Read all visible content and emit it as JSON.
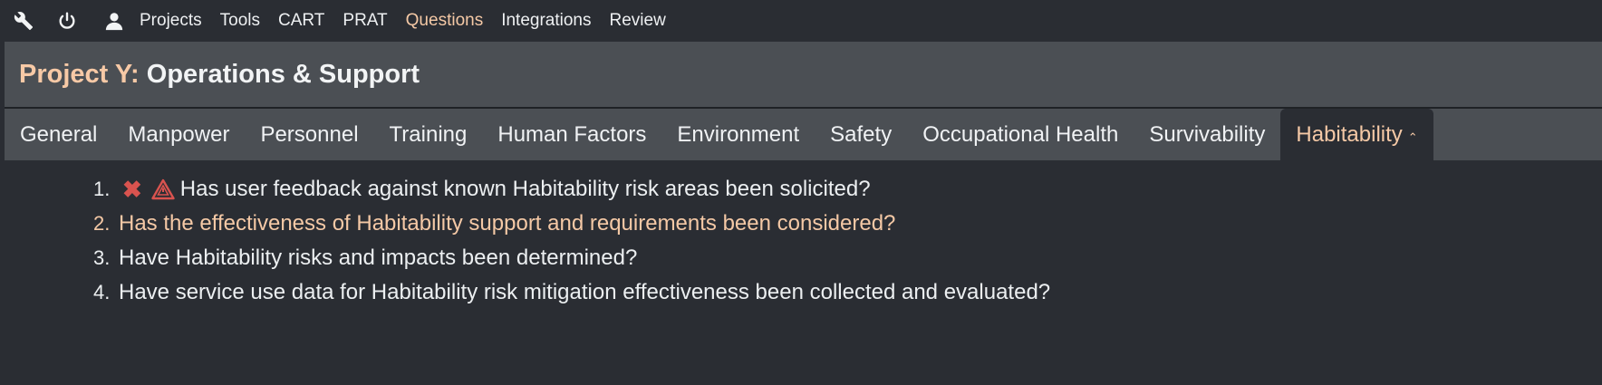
{
  "topnav": {
    "icons": [
      "wrench-icon",
      "power-icon",
      "user-icon"
    ],
    "links": [
      {
        "label": "Projects"
      },
      {
        "label": "Tools"
      },
      {
        "label": "CART"
      },
      {
        "label": "PRAT"
      },
      {
        "label": "Questions"
      },
      {
        "label": "Integrations"
      },
      {
        "label": "Review"
      }
    ],
    "active_link": "Questions"
  },
  "header": {
    "project_name": "Project Y:",
    "subtitle": "Operations & Support"
  },
  "tabs": [
    {
      "label": "General"
    },
    {
      "label": "Manpower"
    },
    {
      "label": "Personnel"
    },
    {
      "label": "Training"
    },
    {
      "label": "Human Factors"
    },
    {
      "label": "Environment"
    },
    {
      "label": "Safety"
    },
    {
      "label": "Occupational Health"
    },
    {
      "label": "Survivability"
    },
    {
      "label": "Habitability"
    }
  ],
  "active_tab": "Habitability",
  "questions": [
    {
      "num": "1.",
      "text": "Has user feedback against known Habitability risk areas been solicited?"
    },
    {
      "num": "2.",
      "text": "Has the effectiveness of Habitability support and requirements been considered?"
    },
    {
      "num": "3.",
      "text": "Have Habitability risks and impacts been determined?"
    },
    {
      "num": "4.",
      "text": "Have service use data for Habitability risk mitigation effectiveness been collected and evaluated?"
    }
  ],
  "colors": {
    "background": "#2a2d33",
    "panel": "#4b4f54",
    "accent": "#f5c9a6",
    "danger": "#d9534f"
  }
}
